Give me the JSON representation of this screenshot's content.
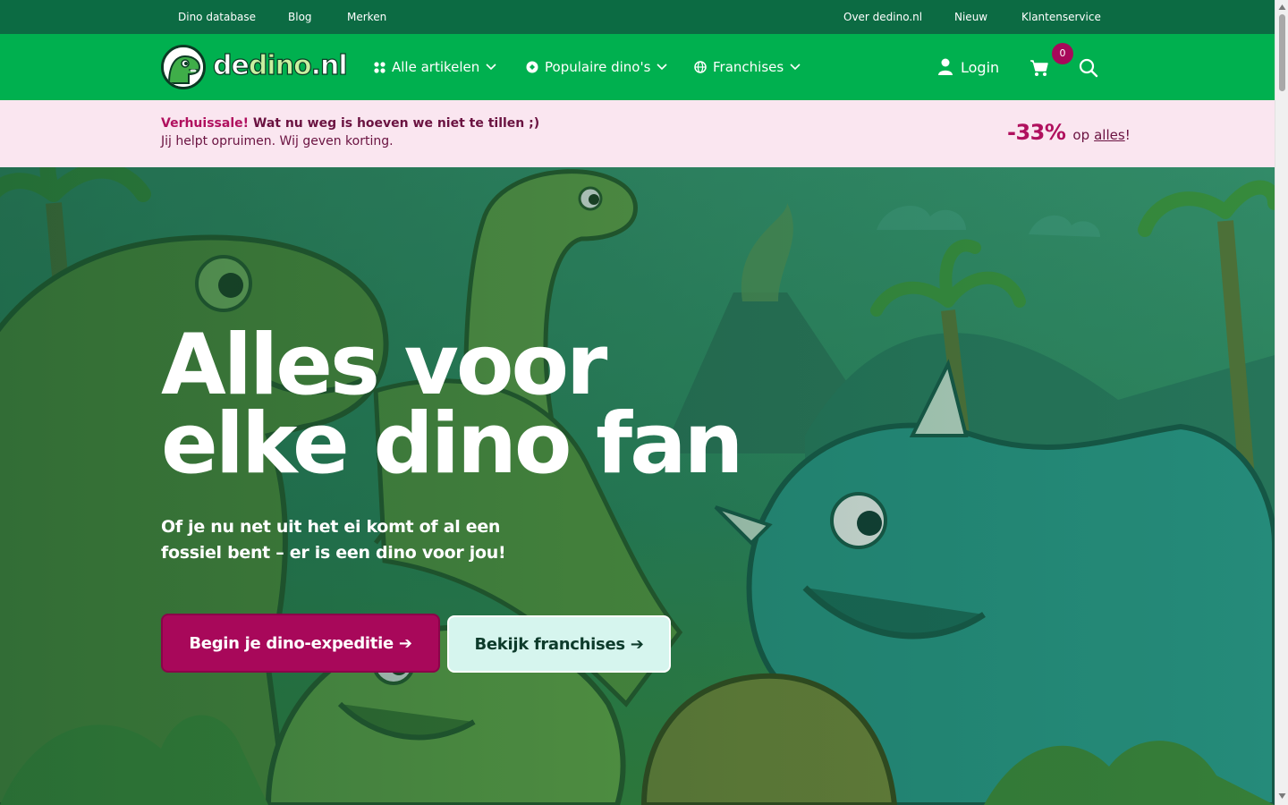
{
  "topbar": {
    "left_links": [
      "Dino database",
      "Blog",
      "Merken"
    ],
    "right_links": [
      "Over dedino.nl",
      "Nieuw",
      "Klantenservice"
    ]
  },
  "logo": {
    "prefix": "de",
    "middle": "dino",
    "suffix": ".nl"
  },
  "nav": {
    "items": [
      {
        "label": "Alle artikelen",
        "icon": "grid-icon"
      },
      {
        "label": "Populaire dino's",
        "icon": "badge-icon"
      },
      {
        "label": "Franchises",
        "icon": "globe-icon"
      }
    ],
    "login_label": "Login",
    "cart_count": "0"
  },
  "promo": {
    "title_highlight": "Verhuissale!",
    "title_rest": "Wat nu weg is hoeven we niet te tillen ;)",
    "subtitle": "Jij helpt opruimen. Wij geven korting.",
    "discount": "-33%",
    "op": "op",
    "alles": "alles",
    "exclaim": "!"
  },
  "hero": {
    "title_line1": "Alles voor",
    "title_line2": "elke dino fan",
    "subtitle": "Of je nu net uit het ei komt of al een fossiel bent – er is een dino voor jou!",
    "primary_button": "Begin je dino-expeditie ➔",
    "secondary_button": "Bekijk franchises ➔"
  },
  "colors": {
    "topbar": "#0c6b43",
    "nav": "#00b04f",
    "promo_bg": "#fae6f0",
    "accent": "#a8085a",
    "secondary_button": "#d6f5ee"
  }
}
